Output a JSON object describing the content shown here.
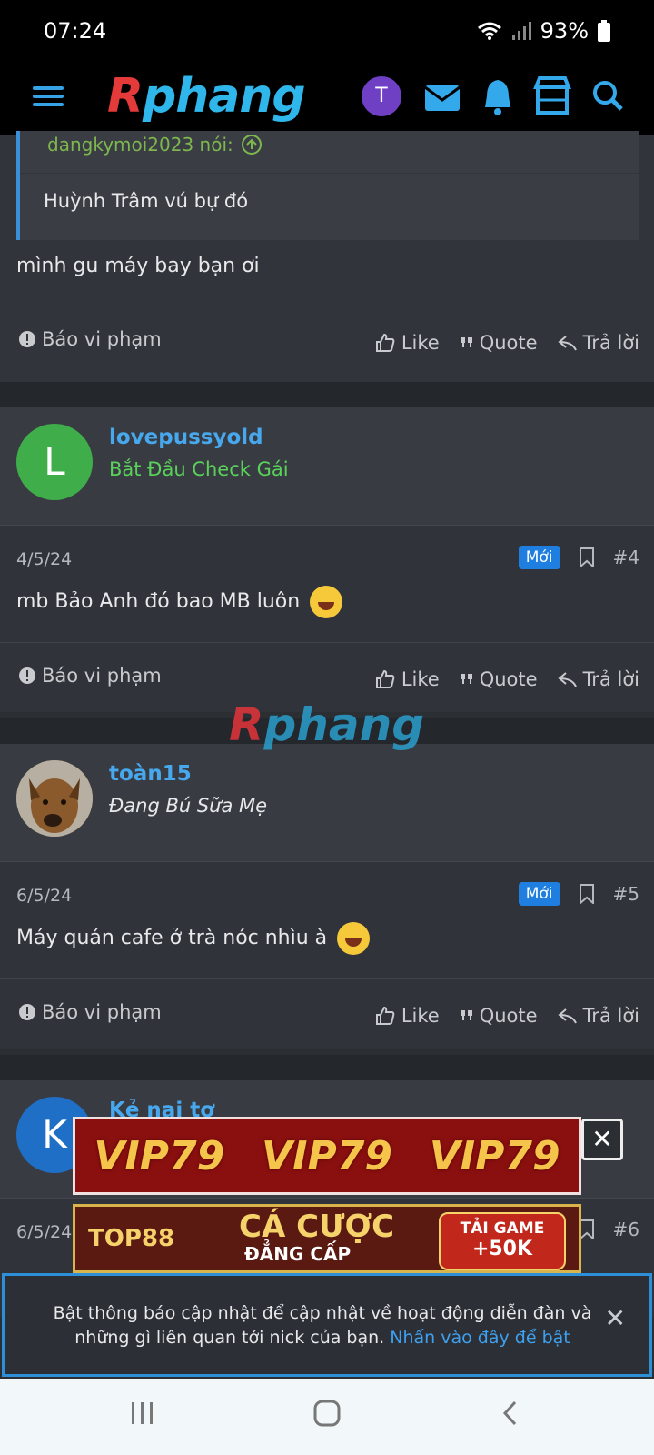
{
  "status": {
    "time": "07:24",
    "battery": "93%"
  },
  "header": {
    "logo_r": "R",
    "logo_rest": "phang",
    "avatar_letter": "T",
    "icons": [
      "menu-icon",
      "envelope-icon",
      "bell-icon",
      "store-icon",
      "search-icon"
    ]
  },
  "quote": {
    "author": "dangkymoi2023 nói:",
    "text": "Huỳnh Trâm vú bự đó"
  },
  "first_post": {
    "text": "mình gu máy bay bạn ơi"
  },
  "actions": {
    "report": "Báo vi phạm",
    "like": "Like",
    "quote": "Quote",
    "reply": "Trả lời"
  },
  "posts": [
    {
      "avatar_letter": "L",
      "avatar_color": "#3fae4a",
      "username": "lovepussyold",
      "user_title": "Bắt Đầu Check Gái",
      "title_color": "#5ad15a",
      "date": "4/5/24",
      "badge": "Mới",
      "number": "#4",
      "text": "mb Bảo Anh đó bao MB luôn"
    },
    {
      "avatar_letter": "",
      "avatar_color": "#8a6a44",
      "username": "toàn15",
      "user_title": "Đang Bú Sữa Mẹ",
      "title_color": "#e6e8ea",
      "date": "6/5/24",
      "badge": "Mới",
      "number": "#5",
      "text": "Máy quán cafe ở trà nóc nhìu à"
    },
    {
      "avatar_letter": "K",
      "avatar_color": "#1f6fc6",
      "username": "Kẻ nai tơ",
      "date": "6/5/24",
      "number": "#6"
    }
  ],
  "watermark": {
    "r": "R",
    "rest": "phang"
  },
  "ads": {
    "vip_text": "VIP79",
    "top88": "TOP88",
    "ca_cuoc": "CÁ CƯỢC",
    "dang_cap": "ĐẲNG CẤP",
    "tai_game": "TẢI GAME",
    "bonus": "+50K",
    "close": "✕"
  },
  "notification": {
    "text": "Bật thông báo cập nhật để cập nhật về hoạt động diễn đàn và những gì liên quan tới nick của bạn.",
    "link": "Nhấn vào đây để bật",
    "close": "✕"
  },
  "navbar": {
    "recent": "|||",
    "home": "◯",
    "back": "‹"
  }
}
